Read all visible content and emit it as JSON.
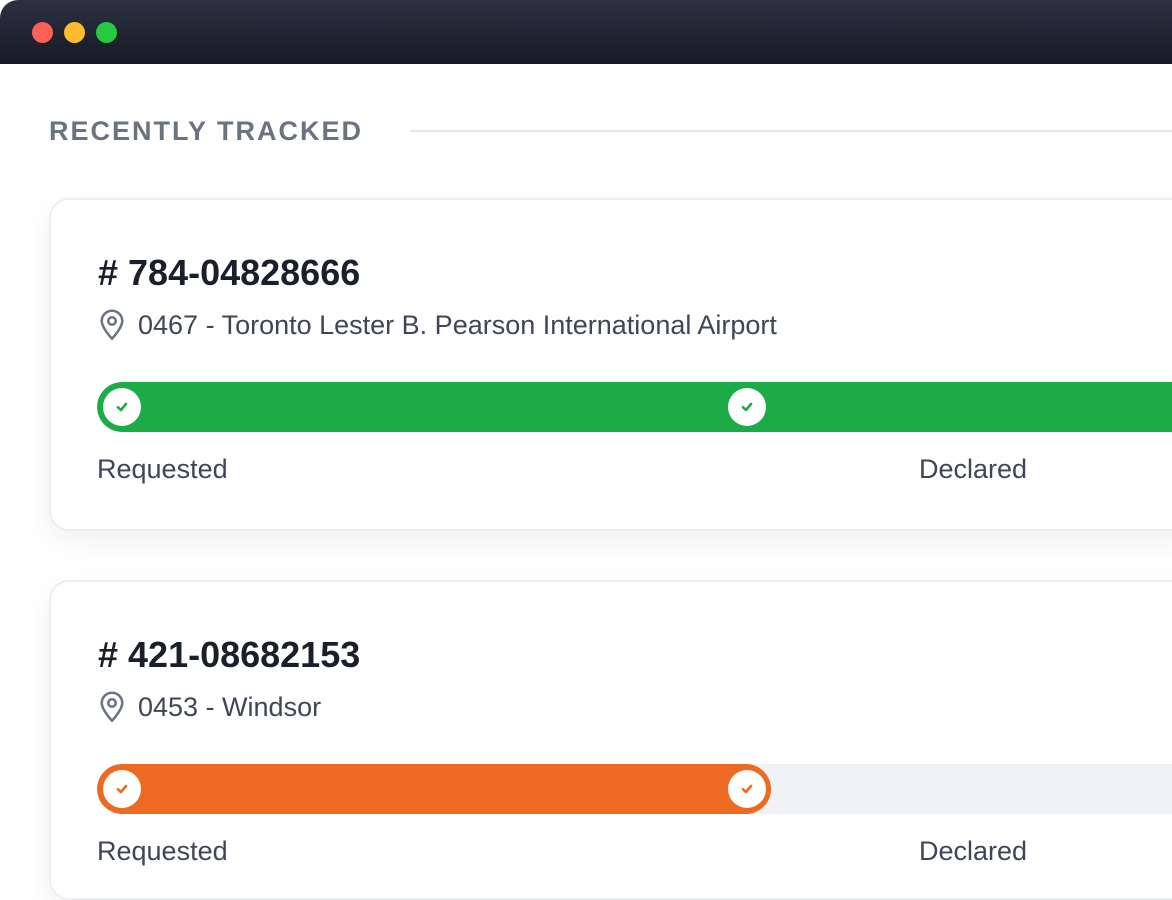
{
  "window": {
    "controls": [
      "close",
      "minimize",
      "maximize"
    ]
  },
  "section": {
    "title": "RECENTLY TRACKED"
  },
  "shipments": [
    {
      "tracking": "# 784-04828666",
      "location": "0467 - Toronto Lester B. Pearson International Airport",
      "status_color": "#1dab47",
      "progress_percent": 100,
      "steps": [
        "Requested",
        "Declared"
      ]
    },
    {
      "tracking": "# 421-08682153",
      "location": "0453 - Windsor",
      "status_color": "#ed6a22",
      "progress_percent": 61,
      "steps": [
        "Requested",
        "Declared"
      ]
    }
  ],
  "icons": {
    "location": "location-pin-icon",
    "step": "check-icon"
  }
}
